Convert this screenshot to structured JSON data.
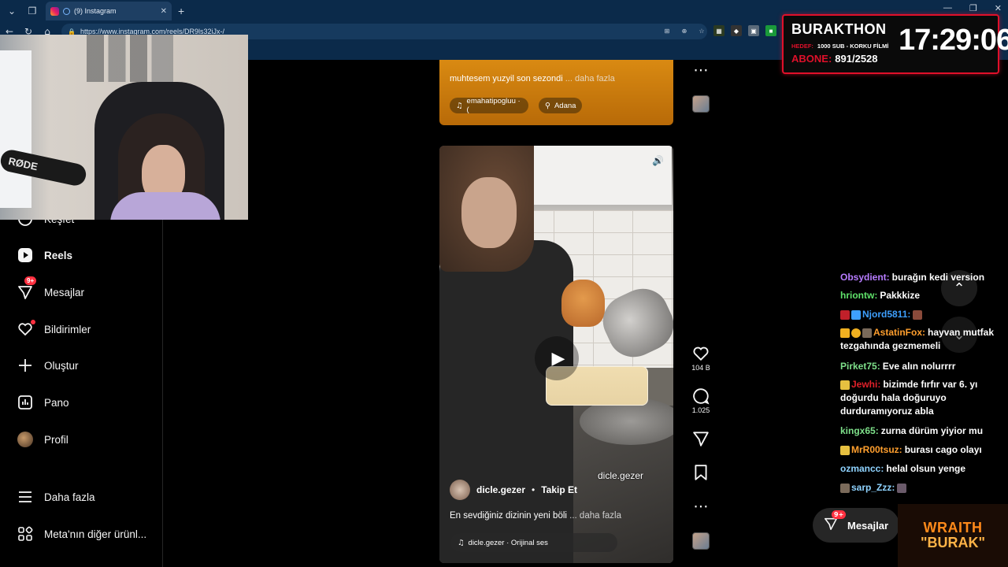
{
  "browser": {
    "tab_title": "(9) Instagram",
    "url": "https://www.instagram.com/reels/DR9ls32iJx-/",
    "new_tab_label": "+"
  },
  "sidebar": {
    "items": [
      {
        "label": "Keşfet"
      },
      {
        "label": "Reels"
      },
      {
        "label": "Mesajlar",
        "badge": "9+"
      },
      {
        "label": "Bildirimler"
      },
      {
        "label": "Oluştur"
      },
      {
        "label": "Pano"
      },
      {
        "label": "Profil"
      },
      {
        "label": "Daha fazla"
      },
      {
        "label": "Meta'nın diğer ürünl..."
      }
    ]
  },
  "reel_prev": {
    "caption": "muhtesem yuzyil son sezondi",
    "more": "... daha fazla",
    "audio": "emahatipogluu · (",
    "location": "Adana"
  },
  "reel": {
    "author": "dicle.gezer",
    "follow": "Takip Et",
    "watermark": "dicle.gezer",
    "caption": "En sevdiğiniz dizinin yeni böli",
    "more": "... daha fazla",
    "audio": "dicle.gezer · Orijinal ses",
    "likes": "104 B",
    "comments": "1.025"
  },
  "float_messages": {
    "label": "Mesajlar",
    "badge": "9+"
  },
  "overlay": {
    "title": "BURAKTHON",
    "hedef_key": "HEDEF:",
    "hedef_val": "1000 SUB - KORKU FİLMİ",
    "abone_key": "ABONE:",
    "abone_val": "891/2528",
    "timer": "17:29:06"
  },
  "chat": [
    {
      "user": "Obsydient:",
      "color": "#b77cff",
      "msg": "burağın kedi version"
    },
    {
      "user": "hriontw:",
      "color": "#5fe36a",
      "msg": "Pakkkize"
    },
    {
      "user": "Njord5811:",
      "color": "#3ea0ff",
      "msg": ""
    },
    {
      "user": "AstatinFox:",
      "color": "#ff9f2e",
      "msg": "hayvan mutfak tezgahında gezmemeli"
    },
    {
      "user": "Pirket75:",
      "color": "#7ee08a",
      "msg": "Eve alın nolurrrr"
    },
    {
      "user": "Jewhi:",
      "color": "#e0202a",
      "msg": "bizimde fırfır var 6. yı doğurdu hala doğuruyo durduramıyoruz abla"
    },
    {
      "user": "kingx65:",
      "color": "#7ee08a",
      "msg": "zurna dürüm yiyior mu"
    },
    {
      "user": "MrR00tsuz:",
      "color": "#ff9f2e",
      "msg": "burası cago olayı"
    },
    {
      "user": "ozmancc:",
      "color": "#8fd3ff",
      "msg": "helal olsun yenge"
    },
    {
      "user": "sarp_Zzz:",
      "color": "#8fd3ff",
      "msg": ""
    }
  ],
  "brand": {
    "line1": "WRAITH",
    "line2": "\"BURAK\""
  },
  "webcam": {
    "mic_label": "RØDE"
  }
}
